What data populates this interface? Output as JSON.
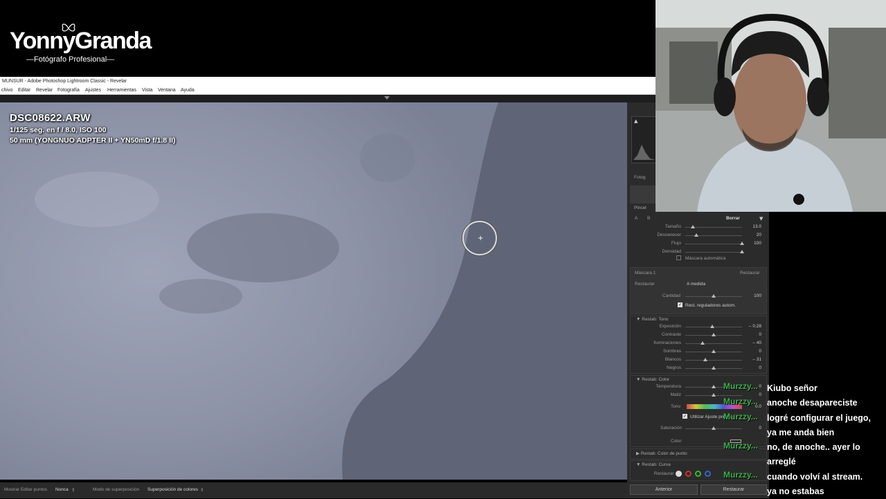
{
  "brand": {
    "name": "YonnyGranda",
    "subtitle": "—Fotógrafo Profesional—"
  },
  "window": {
    "title": "MUNSUR - Adobe Photoshop Lightroom Classic - Revelar"
  },
  "menu": [
    "chivo",
    "Editar",
    "Revelar",
    "Fotografía",
    "Ajustes",
    "Herramientas",
    "Vista",
    "Ventana",
    "Ayuda"
  ],
  "photo": {
    "file_name": "DSC08622.ARW",
    "exposure": "1/125 seg. en f / 8.0, ISO 100",
    "lens": "50 mm (YONGNUO ADPTER II + YN50mD f/1.8 II)"
  },
  "bottom_bar": {
    "show_label": "Mostrar Editar puntos",
    "show_value": "Nunca",
    "overlay_mode_label": "Modo de superposición",
    "overlay_mode_value": "Superposición de colores"
  },
  "panel": {
    "histogram_label": "Fotog",
    "brush_title": "Pincel",
    "brush_a": "A",
    "brush_b": "B",
    "brush_mode": "Borrar",
    "brush_settings": [
      {
        "label": "Tamaño",
        "value": "13.0",
        "pos": 0.14
      },
      {
        "label": "Desvanecer",
        "value": "20",
        "pos": 0.2
      },
      {
        "label": "Flujo",
        "value": "100",
        "pos": 1.0
      },
      {
        "label": "Densidad",
        "value": "",
        "pos": 1.0
      }
    ],
    "auto_mask": "Máscara automática",
    "mask_name": "Máscara 1",
    "mask_reset": "Restaurar",
    "restore_label": "Restaurar",
    "restore_value": "A medida",
    "amount_label": "Cantidad",
    "amount_value": "100",
    "amount_pos": 0.5,
    "reset_sliders": "Rest. reguladores autom.",
    "tone_title": "Restab: Tono",
    "tone": [
      {
        "label": "Exposición",
        "value": "– 0.28",
        "pos": 0.47
      },
      {
        "label": "Contraste",
        "value": "0",
        "pos": 0.5
      },
      {
        "label": "Iluminaciones",
        "value": "– 40",
        "pos": 0.3
      },
      {
        "label": "Sombras",
        "value": "0",
        "pos": 0.5
      },
      {
        "label": "Blancos",
        "value": "– 31",
        "pos": 0.35
      },
      {
        "label": "Negros",
        "value": "0",
        "pos": 0.5
      }
    ],
    "color_title": "Restab: Color",
    "color": [
      {
        "label": "Temperatura",
        "value": "0",
        "pos": 0.5
      },
      {
        "label": "Matiz",
        "value": "0",
        "pos": 0.5
      }
    ],
    "tint_label": "Tono",
    "tint_value": "0.0",
    "use_fine": "Utilizar Ajuste preciso",
    "saturation_label": "Saturación",
    "saturation_value": "0",
    "color_label": "Color",
    "point_color_title": "Restab: Color de punto",
    "curve_title": "Restab: Curva",
    "curve_reset": "Restaurar",
    "prev_button": "Anterior",
    "reset_button": "Restaurar"
  },
  "overlay_user": "Murzzy...",
  "chat": [
    "Kiubo señor",
    "anoche desapareciste",
    "logré configurar el juego,",
    "ya me anda bien",
    "no, de anoche.. ayer lo",
    "arreglé",
    "cuando volví al stream.",
    "ya no estabas"
  ],
  "colors": {
    "accent_overlay": "#3db04a",
    "panel_bg": "#2b2b2b",
    "photo_tone": "#5c6173"
  }
}
